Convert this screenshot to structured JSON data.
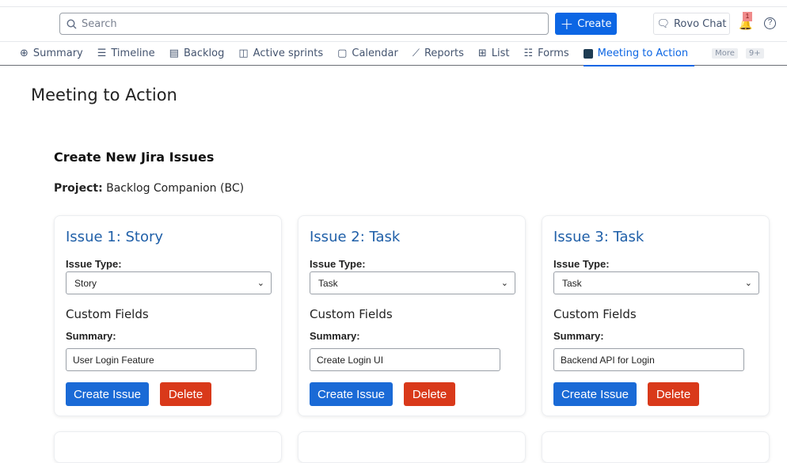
{
  "header": {
    "search_placeholder": "Search",
    "create_label": "Create",
    "rovo_label": "Rovo Chat",
    "notification_count": "1",
    "help": "?"
  },
  "tabs": [
    {
      "label": "Summary",
      "icon": "globe-icon"
    },
    {
      "label": "Timeline",
      "icon": "timeline-icon"
    },
    {
      "label": "Backlog",
      "icon": "backlog-icon"
    },
    {
      "label": "Active sprints",
      "icon": "board-icon"
    },
    {
      "label": "Calendar",
      "icon": "calendar-icon"
    },
    {
      "label": "Reports",
      "icon": "chart-icon"
    },
    {
      "label": "List",
      "icon": "list-icon"
    },
    {
      "label": "Forms",
      "icon": "forms-icon"
    },
    {
      "label": "Meeting to Action",
      "icon": "app-icon",
      "active": true
    }
  ],
  "more": {
    "label": "More",
    "count": "9+"
  },
  "page": {
    "title": "Meeting to Action",
    "section_title": "Create New Jira Issues",
    "project_label": "Project:",
    "project_value": "Backlog Companion (BC)"
  },
  "labels": {
    "issue_type": "Issue Type:",
    "custom_fields": "Custom Fields",
    "summary": "Summary:",
    "create_issue": "Create Issue",
    "delete": "Delete"
  },
  "issues": [
    {
      "title": "Issue 1: Story",
      "type": "Story",
      "summary": "User Login Feature"
    },
    {
      "title": "Issue 2: Task",
      "type": "Task",
      "summary": "Create Login UI"
    },
    {
      "title": "Issue 3: Task",
      "type": "Task",
      "summary": "Backend API for Login"
    }
  ],
  "colors": {
    "primary": "#1a6ad6",
    "danger": "#d9391a",
    "title": "#1f5fa8"
  }
}
